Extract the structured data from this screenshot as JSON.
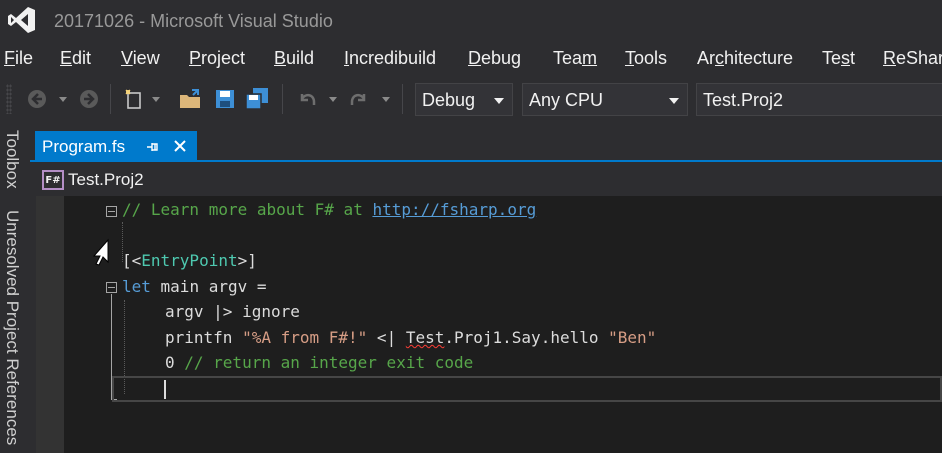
{
  "window": {
    "title": "20171026 - Microsoft Visual Studio"
  },
  "menu": [
    {
      "label": "File",
      "u": "F",
      "rest": "ile"
    },
    {
      "label": "Edit",
      "u": "E",
      "rest": "dit"
    },
    {
      "label": "View",
      "u": "V",
      "rest": "iew"
    },
    {
      "label": "Project",
      "u": "P",
      "rest": "roject"
    },
    {
      "label": "Build",
      "u": "B",
      "rest": "uild"
    },
    {
      "label": "Incredibuild",
      "u": "I",
      "rest": "ncredibuild"
    },
    {
      "label": "Debug",
      "u": "D",
      "rest": "ebug"
    },
    {
      "label": "Team",
      "pre": "Tea",
      "u": "m",
      "rest": ""
    },
    {
      "label": "Tools",
      "u": "T",
      "rest": "ools"
    },
    {
      "label": "Architecture",
      "pre": "Ar",
      "u": "c",
      "rest": "hitecture"
    },
    {
      "label": "Test",
      "pre": "Te",
      "u": "s",
      "rest": "t"
    },
    {
      "label": "ReSharper",
      "u": "R",
      "rest": "eSharper"
    }
  ],
  "toolbar": {
    "config": "Debug",
    "platform": "Any CPU",
    "startup_project": "Test.Proj2",
    "icons": [
      "back-icon",
      "forward-icon",
      "new-project-icon",
      "open-file-icon",
      "save-icon",
      "save-all-icon",
      "undo-icon",
      "redo-icon"
    ]
  },
  "side_tabs": {
    "toolbox": "Toolbox",
    "unresolved": "Unresolved Project References"
  },
  "document_tab": {
    "name": "Program.fs"
  },
  "navbar": {
    "icon_text": "F#",
    "project": "Test.Proj2"
  },
  "code": {
    "line1_comment": "// Learn more about F# at ",
    "line1_link": "http://fsharp.org",
    "line3_open": "[<",
    "line3_type": "EntryPoint",
    "line3_close": ">]",
    "line4_kw": "let",
    "line4_rest": " main argv =",
    "line5": "argv |> ignore",
    "line6_fn": "printfn ",
    "line6_str": "\"%A from F#!\"",
    "line6_op": " <| ",
    "line6_squiggle": "Test",
    "line6_call": ".Proj1.Say.hello ",
    "line6_arg": "\"Ben\"",
    "line7_num": "0 ",
    "line7_comment": "// return an integer exit code"
  },
  "colors": {
    "accent": "#007acc",
    "background": "#1e1e1e",
    "chrome": "#2d2d30"
  }
}
